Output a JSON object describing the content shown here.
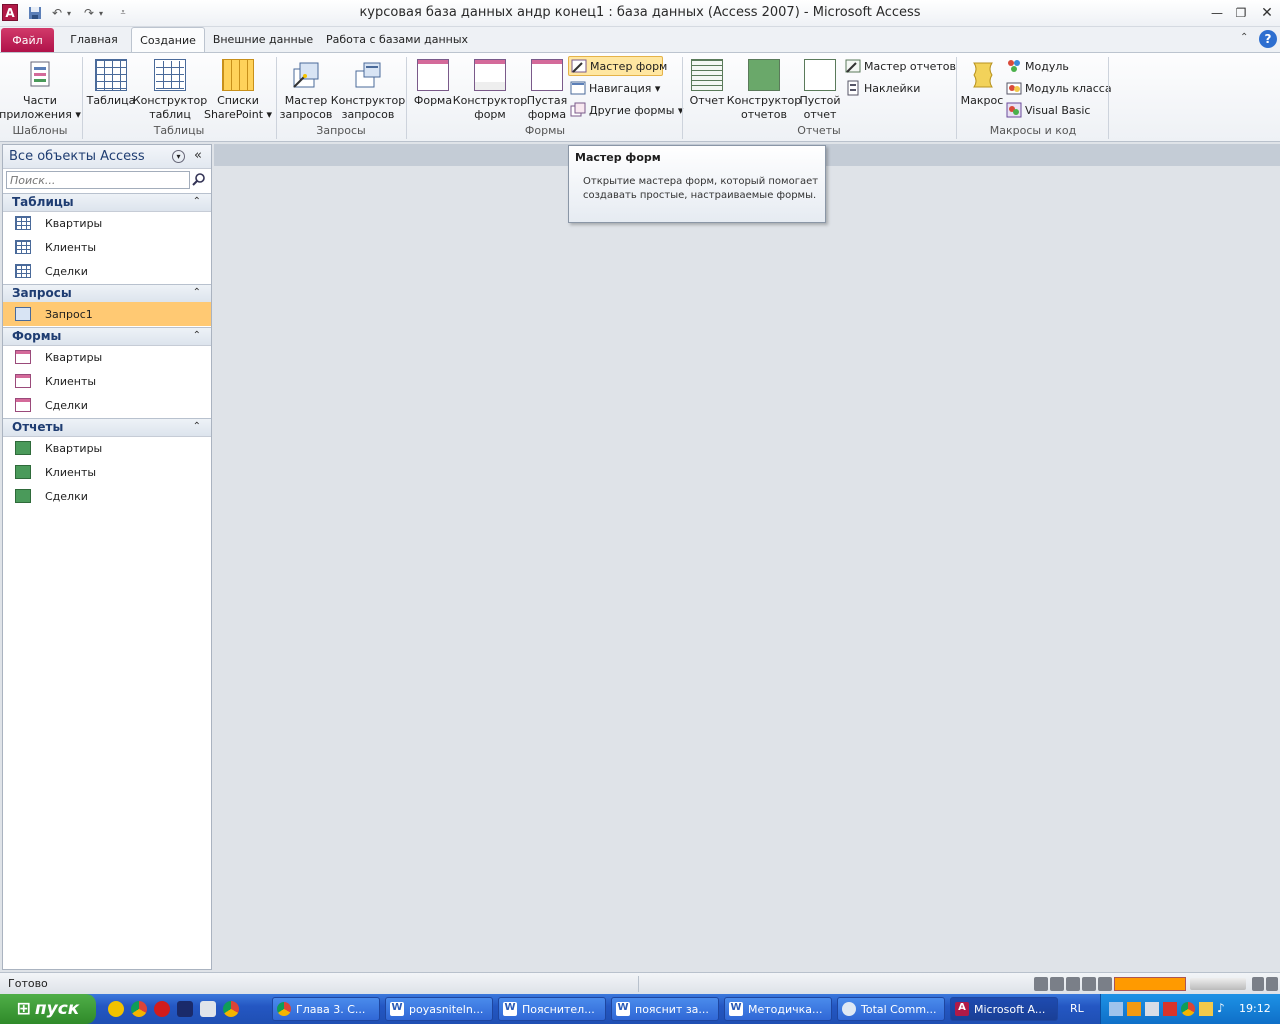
{
  "window": {
    "title": "курсовая база данных андр конец1 : база данных (Access 2007)  -  Microsoft Access",
    "app_icon_letter": "A"
  },
  "tabs": [
    {
      "label": "Файл"
    },
    {
      "label": "Главная"
    },
    {
      "label": "Создание"
    },
    {
      "label": "Внешние данные"
    },
    {
      "label": "Работа с базами данных"
    }
  ],
  "ribbon": {
    "groups": {
      "templates": "Шаблоны",
      "tables": "Таблицы",
      "queries": "Запросы",
      "forms": "Формы",
      "reports": "Отчеты",
      "macros": "Макросы и код"
    },
    "buttons": {
      "app_parts": "Части\nприложения ▾",
      "table": "Таблица",
      "table_design": "Конструктор\nтаблиц",
      "sharepoint": "Списки\nSharePoint ▾",
      "query_wizard": "Мастер\nзапросов",
      "query_design": "Конструктор\nзапросов",
      "form": "Форма",
      "form_design": "Конструктор\nформ",
      "blank_form": "Пустая\nформа",
      "form_wizard": "Мастер форм",
      "navigation": "Навигация ▾",
      "other_forms": "Другие формы ▾",
      "report": "Отчет",
      "report_design": "Конструктор\nотчетов",
      "blank_report": "Пустой\nотчет",
      "report_wizard": "Мастер отчетов",
      "labels": "Наклейки",
      "macro": "Макрос",
      "module": "Модуль",
      "class_module": "Модуль класса",
      "visual_basic": "Visual Basic"
    }
  },
  "tooltip": {
    "title": "Мастер форм",
    "body": "Открытие мастера форм, который помогает создавать простые, настраиваемые формы."
  },
  "nav": {
    "title": "Все объекты Access",
    "search_placeholder": "Поиск...",
    "sections": [
      {
        "title": "Таблицы",
        "items": [
          "Квартиры",
          "Клиенты",
          "Сделки"
        ]
      },
      {
        "title": "Запросы",
        "items": [
          "Запрос1"
        ]
      },
      {
        "title": "Формы",
        "items": [
          "Квартиры",
          "Клиенты",
          "Сделки"
        ]
      },
      {
        "title": "Отчеты",
        "items": [
          "Квартиры",
          "Клиенты",
          "Сделки"
        ]
      }
    ]
  },
  "status": {
    "text": "Готово"
  },
  "taskbar": {
    "start": "пуск",
    "items": [
      "Глава 3. С...",
      "poyasniteln...",
      "Пояснител...",
      "пояснит за...",
      "Методичка...",
      "Total Comm...",
      "Microsoft A..."
    ],
    "lang": "RL",
    "clock": "19:12"
  },
  "colors": {
    "file_tab": "#c41f55",
    "selected_item": "#ffc973",
    "nav_header_text": "#1f3d72",
    "taskbar": "#2457c3"
  }
}
